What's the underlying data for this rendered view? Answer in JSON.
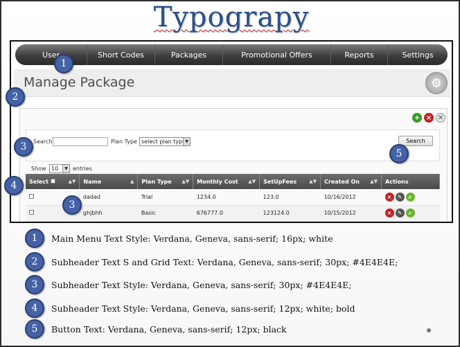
{
  "slide": {
    "title": "Typograpy"
  },
  "menu": {
    "items": [
      "User",
      "Short Codes",
      "Packages",
      "Promotional Offers",
      "Reports",
      "Settings"
    ]
  },
  "page": {
    "title": "Manage Package"
  },
  "search": {
    "label": "Search",
    "value": "",
    "plan_type_label": "Plan Type",
    "plan_type_selected": "select plan type",
    "button_label": "Search"
  },
  "entries": {
    "show_label": "Show",
    "count": "10",
    "entries_label": "entries"
  },
  "table": {
    "headers": [
      "Select",
      "Name",
      "Plan Type",
      "Monthly Cost",
      "SetUpFees",
      "Created On",
      "Actions"
    ],
    "rows": [
      [
        "",
        "dadad",
        "Trial",
        "1234.0",
        "123.0",
        "10/16/2012",
        ""
      ],
      [
        "",
        "ghjbhh",
        "Basic",
        "676777.0",
        "123124.0",
        "10/15/2012",
        ""
      ]
    ]
  },
  "badges": [
    "1",
    "2",
    "3",
    "4",
    "5",
    "3"
  ],
  "legend": [
    {
      "num": "1",
      "text": "Main Menu Text Style: Verdana, Geneva, sans-serif; 16px; white"
    },
    {
      "num": "2",
      "text": "Subheader Text S and Grid Text: Verdana, Geneva, sans-serif;  30px; #4E4E4E;"
    },
    {
      "num": "3",
      "text": "Subheader Text Style: Verdana, Geneva, sans-serif;  30px; #4E4E4E;"
    },
    {
      "num": "4",
      "text": "Subheader Text Style: Verdana, Geneva, sans-serif; 12px; white; bold"
    },
    {
      "num": "5",
      "text": "Button Text: Verdana, Geneva, sans-serif; 12px;  black"
    }
  ],
  "colors": {
    "title": "#2e4f86",
    "badge": "#4462a6",
    "subheader_text": "#4E4E4E",
    "menu_bar": "#3e3e3e"
  },
  "icons": [
    "gear-icon",
    "add-icon",
    "delete-icon",
    "tools-icon",
    "edit-icon",
    "view-icon"
  ]
}
